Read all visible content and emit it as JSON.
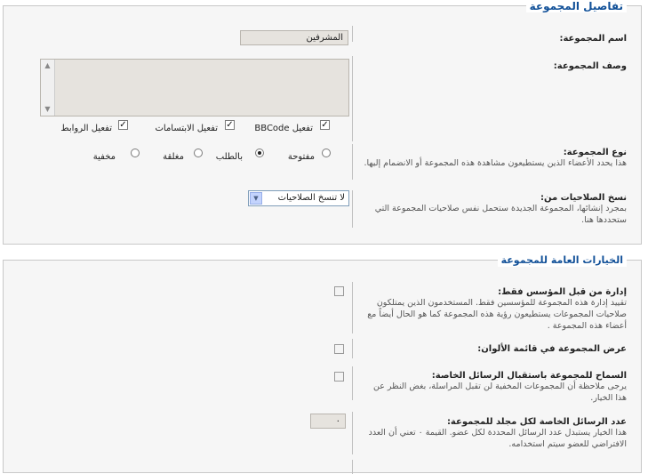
{
  "group_details": {
    "legend": "تفاصيل المجموعة",
    "name": {
      "label": "اسم المجموعة:",
      "value": "المشرفين"
    },
    "description": {
      "label": "وصف المجموعة:",
      "value": ""
    },
    "parse_options": [
      {
        "label": "تفعيل BBCode",
        "checked": true
      },
      {
        "label": "تفعيل الابتسامات",
        "checked": true
      },
      {
        "label": "تفعيل الروابط",
        "checked": true
      }
    ],
    "type": {
      "label": "نوع المجموعة:",
      "explain": "هذا يحدد الأعضاء الذين يستطيعون مشاهدة هذه المجموعة أو الانضمام إليها.",
      "options": [
        {
          "label": "مفتوحة",
          "selected": false
        },
        {
          "label": "بالطلب",
          "selected": true
        },
        {
          "label": "مغلقة",
          "selected": false
        },
        {
          "label": "مخفية",
          "selected": false
        }
      ]
    },
    "copy_permissions": {
      "label": "نسخ الصلاحيات من:",
      "explain": "بمجرد إنشائها، المجموعة الجديدة ستحمل نفس صلاحيات المجموعة التي ستحددها هنا.",
      "selected": "لا تنسخ الصلاحيات"
    }
  },
  "group_settings": {
    "legend": "الخيارات العامة للمجموعة",
    "founder_manage": {
      "label": "إدارة من قبل المؤسس فقط:",
      "explain": "تقييد إدارة هذه المجموعة للمؤسسين فقط. المستخدمون الذين يمتلكون صلاحيات المجموعات يستطيعون رؤية هذه المجموعة كما هو الحال أيضاً مع أعضاء هذه المجموعة ."
    },
    "legend_display": {
      "label": "عرض المجموعة في قائمة الألوان:"
    },
    "receive_pm": {
      "label": "السماح للمجموعة باستقبال الرسائل الخاصة:",
      "explain": "يرجى ملاحظة أن المجموعات المخفية لن تقبل المراسلة، بغض النظر عن هذا الخيار."
    },
    "message_limit": {
      "label": "عدد الرسائل الخاصة لكل مجلد للمجموعة:",
      "explain": "هذا الخيار يستبدل عدد الرسائل المحددة لكل عضو. القيمة ٠ تعني أن العدد الافتراضي للعضو سيتم استخدامه.",
      "value": "٠"
    }
  }
}
